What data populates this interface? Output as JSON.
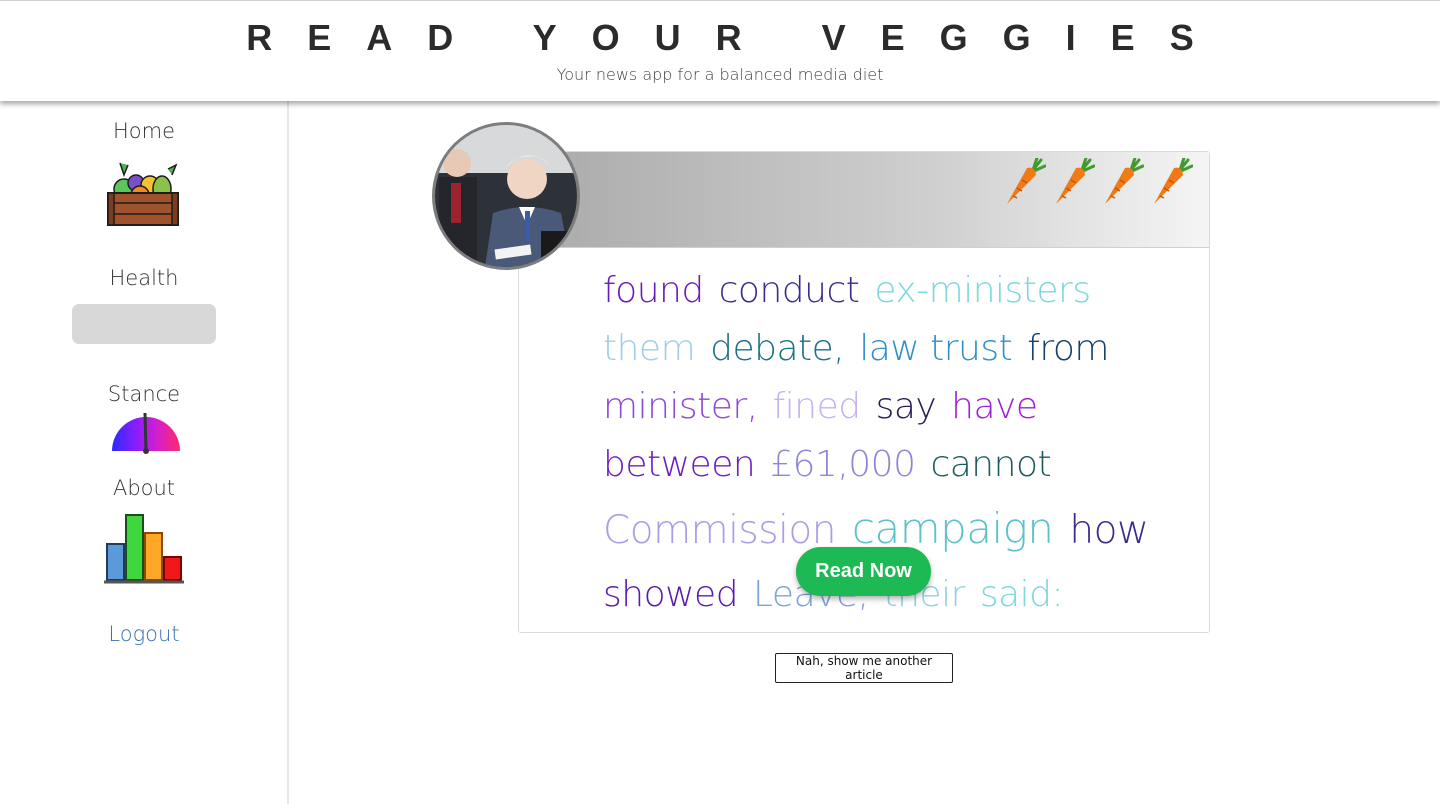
{
  "header": {
    "title": "READ YOUR VEGGIES",
    "subtitle": "Your news app for a balanced media diet"
  },
  "sidebar": {
    "items": [
      {
        "label": "Home",
        "icon": "veggie-crate-icon"
      },
      {
        "label": "Health",
        "icon": "health-bar"
      },
      {
        "label": "Stance",
        "icon": "stance-gauge-icon"
      },
      {
        "label": "About",
        "icon": "bar-chart-icon"
      },
      {
        "label": "Logout"
      }
    ]
  },
  "article": {
    "rating_icon": "carrot-icon",
    "rating_count": 4,
    "thumbnail": "article-photo",
    "word_lines": [
      [
        {
          "text": "found",
          "color": "#6a1bb5"
        },
        {
          "text": "conduct",
          "color": "#3c2a8f"
        },
        {
          "text": "ex-ministers",
          "color": "#7ad8de"
        }
      ],
      [
        {
          "text": "them",
          "color": "#9ecfe4"
        },
        {
          "text": "debate,",
          "color": "#1d6f8a"
        },
        {
          "text": "law trust",
          "color": "#2f8fc6"
        },
        {
          "text": "from",
          "color": "#14406e"
        }
      ],
      [
        {
          "text": "minister,",
          "color": "#8a4bd6"
        },
        {
          "text": "fined",
          "color": "#c6b3ee"
        },
        {
          "text": "say",
          "color": "#2a1a55"
        },
        {
          "text": "have",
          "color": "#9e1fd8"
        }
      ],
      [
        {
          "text": "between",
          "color": "#6d1ec2"
        },
        {
          "text": "£61,000",
          "color": "#8a86d8"
        },
        {
          "text": "cannot",
          "color": "#1d5a5e"
        }
      ],
      [
        {
          "text": "Commission",
          "color": "#a99ee6"
        },
        {
          "text": "campaign",
          "color": "#5bc3c8"
        },
        {
          "text": "how",
          "color": "#3b2a8c"
        }
      ],
      [
        {
          "text": "showed",
          "color": "#5a1ab0"
        },
        {
          "text": "Leave,",
          "color": "#7da2dc"
        },
        {
          "text": "their",
          "color": "#8fd0e8"
        },
        {
          "text": "said:",
          "color": "#7ad8de"
        }
      ]
    ],
    "read_now_label": "Read Now",
    "another_label": "Nah, show me another article",
    "accent_color": "#1db954"
  }
}
